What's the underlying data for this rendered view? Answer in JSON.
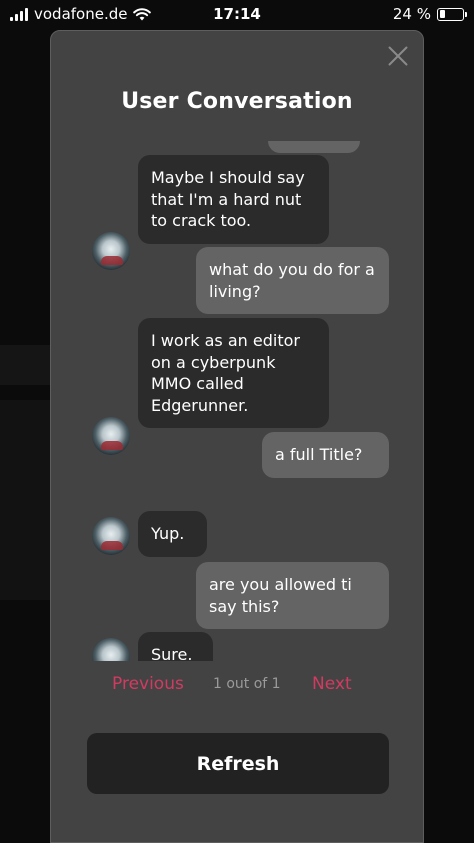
{
  "status_bar": {
    "carrier": "vodafone.de",
    "time": "17:14",
    "battery_percent": "24 %",
    "battery_level": 0.24
  },
  "modal": {
    "title": "User Conversation"
  },
  "messages": [
    {
      "from": "user",
      "text": ""
    },
    {
      "from": "bot",
      "text": "Maybe I should say that I'm a hard nut to crack too."
    },
    {
      "from": "user",
      "text": "what do you do for a living?"
    },
    {
      "from": "bot",
      "text": "I work as an editor on a cyberpunk MMO called Edgerunner."
    },
    {
      "from": "user",
      "text": "a full Title?"
    },
    {
      "from": "bot",
      "text": "Yup."
    },
    {
      "from": "user",
      "text": "are you allowed ti say this?"
    },
    {
      "from": "bot",
      "text": "Sure."
    }
  ],
  "pagination": {
    "previous_label": "Previous",
    "page_info": "1 out of 1",
    "next_label": "Next"
  },
  "refresh_label": "Refresh",
  "colors": {
    "accent": "#d13b62",
    "modal_bg": "#434343",
    "bot_bubble": "#2b2b2b",
    "user_bubble": "#646464"
  }
}
